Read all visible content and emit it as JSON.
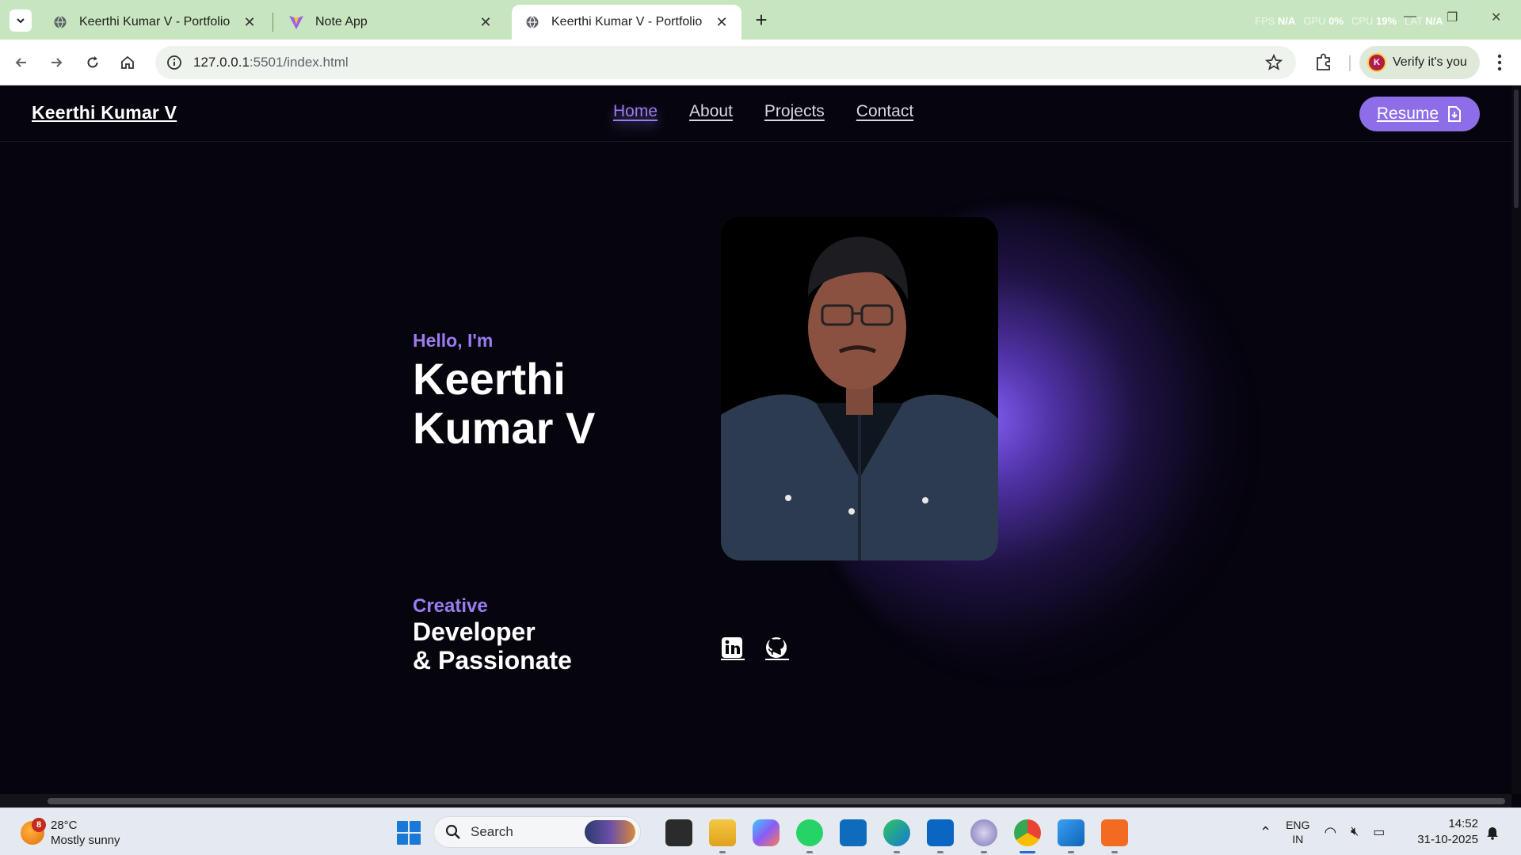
{
  "browser": {
    "tabs": [
      {
        "title": "Keerthi Kumar V - Portfolio",
        "active": false
      },
      {
        "title": "Note App",
        "active": false
      },
      {
        "title": "Keerthi Kumar V - Portfolio",
        "active": true
      }
    ],
    "perf": {
      "fps_label": "FPS",
      "fps": "N/A",
      "gpu_label": "GPU",
      "gpu": "0%",
      "cpu_label": "CPU",
      "cpu": "19%",
      "lat_label": "LAT",
      "lat": "N/A"
    },
    "url_host": "127.0.0.1",
    "url_rest": ":5501/index.html",
    "profile_initial": "K",
    "verify_label": "Verify it's you"
  },
  "site": {
    "brand": "Keerthi Kumar V",
    "nav": [
      "Home",
      "About",
      "Projects",
      "Contact"
    ],
    "active_nav": "Home",
    "resume_label": "Resume",
    "hello": "Hello, I'm",
    "name_line1": "Keerthi",
    "name_line2": "Kumar V",
    "tag_accent": "Creative",
    "tag_line1": "Developer",
    "tag_line2": "& Passionate",
    "accent_color": "#8d6ee8"
  },
  "taskbar": {
    "weather_badge": "8",
    "temperature": "28°C",
    "condition": "Mostly sunny",
    "search_label": "Search",
    "lang_line1": "ENG",
    "lang_line2": "IN",
    "time": "14:52",
    "date": "31-10-2025"
  }
}
